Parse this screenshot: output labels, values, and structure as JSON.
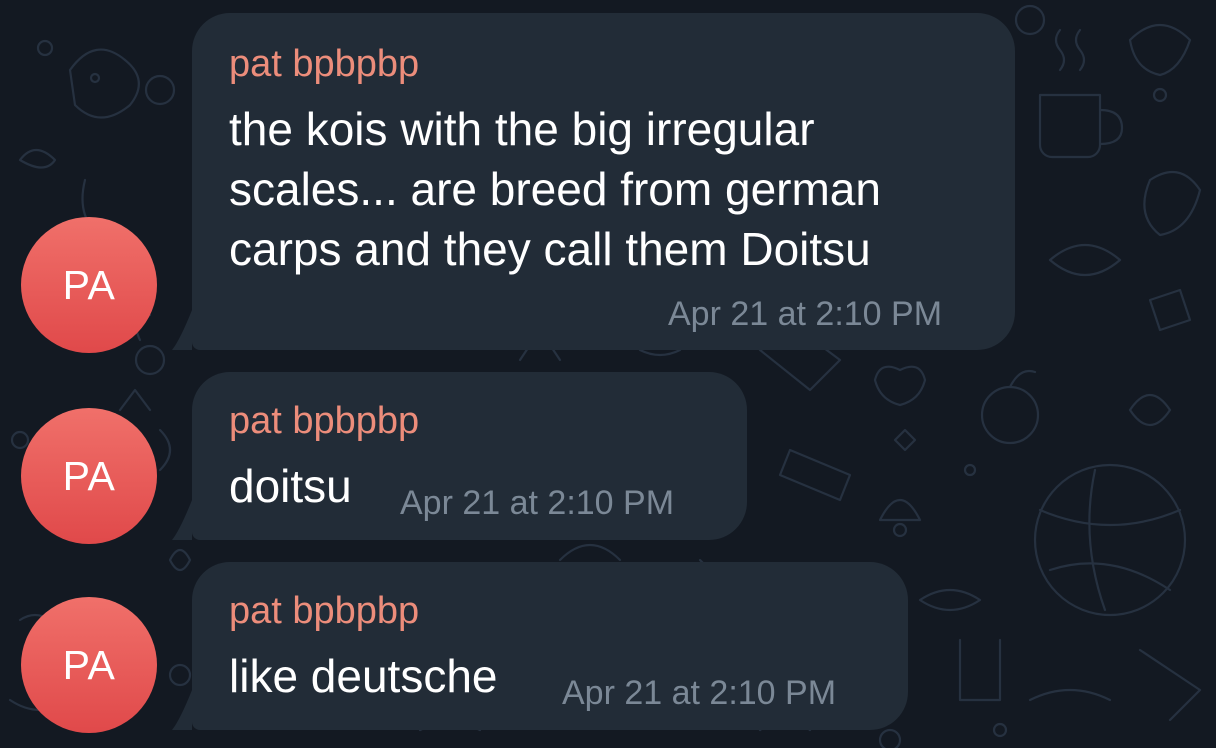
{
  "chat": {
    "messages": [
      {
        "avatar_initials": "PA",
        "sender": "pat bpbpbp",
        "lines": [
          "the kois with the big irregular",
          "scales... are breed from german",
          "carps and they call them Doitsu"
        ],
        "time": "Apr 21 at 2:10 PM"
      },
      {
        "avatar_initials": "PA",
        "sender": "pat bpbpbp",
        "lines": [
          "doitsu"
        ],
        "time": "Apr 21 at 2:10 PM"
      },
      {
        "avatar_initials": "PA",
        "sender": "pat bpbpbp",
        "lines": [
          "like deutsche"
        ],
        "time": "Apr 21 at 2:10 PM"
      }
    ]
  },
  "colors": {
    "background": "#131922",
    "bubble": "#222c37",
    "sender_name": "#ec8d7b",
    "timestamp": "#7b8896",
    "avatar": "#e85a56"
  }
}
